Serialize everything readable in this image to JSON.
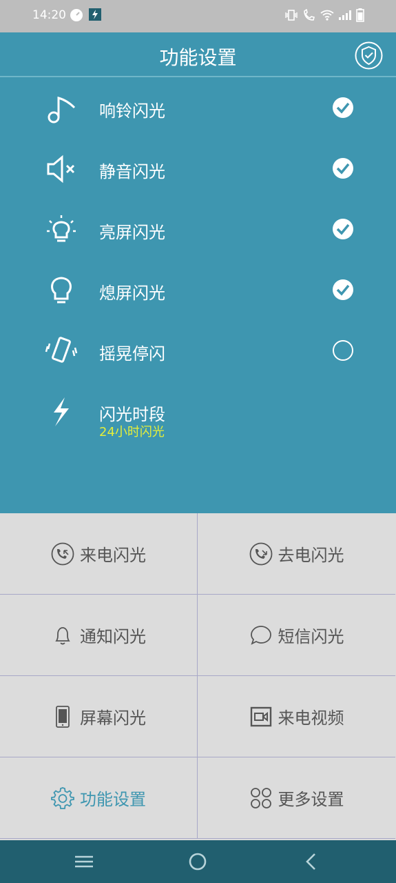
{
  "status_bar": {
    "time": "14:20"
  },
  "header": {
    "title": "功能设置"
  },
  "settings": [
    {
      "label": "响铃闪光",
      "checked": true,
      "icon": "music-note-icon"
    },
    {
      "label": "静音闪光",
      "checked": true,
      "icon": "mute-speaker-icon"
    },
    {
      "label": "亮屏闪光",
      "checked": true,
      "icon": "bulb-on-icon"
    },
    {
      "label": "熄屏闪光",
      "checked": true,
      "icon": "bulb-off-icon"
    },
    {
      "label": "摇晃停闪",
      "checked": false,
      "icon": "shake-phone-icon"
    },
    {
      "label": "闪光时段",
      "sublabel": "24小时闪光",
      "icon": "lightning-icon"
    }
  ],
  "grid": [
    {
      "label": "来电闪光",
      "icon": "incoming-call-icon"
    },
    {
      "label": "去电闪光",
      "icon": "outgoing-call-icon"
    },
    {
      "label": "通知闪光",
      "icon": "bell-icon"
    },
    {
      "label": "短信闪光",
      "icon": "chat-bubble-icon"
    },
    {
      "label": "屏幕闪光",
      "icon": "phone-screen-icon"
    },
    {
      "label": "来电视频",
      "icon": "video-icon"
    },
    {
      "label": "功能设置",
      "icon": "gear-icon",
      "active": true
    },
    {
      "label": "更多设置",
      "icon": "grid-dots-icon"
    }
  ],
  "colors": {
    "primary": "#3e96b0",
    "accent_yellow": "#e4ee3a",
    "nav_bar": "#215f6f",
    "grid_bg": "#dcdcdc"
  }
}
